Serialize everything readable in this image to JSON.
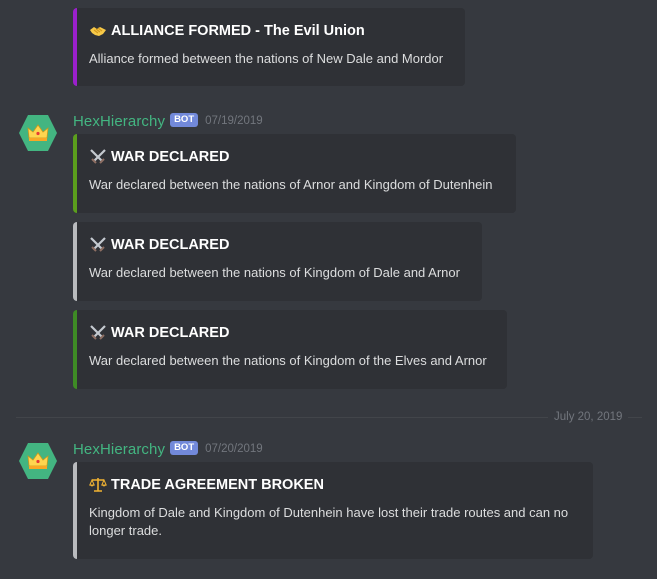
{
  "messages": [
    {
      "embeds": [
        {
          "emoji": "handshake-icon",
          "color": "#9b20cc",
          "title": "ALLIANCE FORMED - The Evil Union",
          "description": "Alliance formed between the nations of New Dale and Mordor"
        }
      ]
    },
    {
      "author": "HexHierarchy",
      "tag": "BOT",
      "timestamp": "07/19/2019",
      "avatar_icon": "crown-icon",
      "avatar_color": "#43b581",
      "embeds": [
        {
          "emoji": "crossed-swords-icon",
          "color": "#5b9e1d",
          "title": "WAR DECLARED",
          "description": "War declared between the nations of Arnor and Kingdom of Dutenhein"
        },
        {
          "emoji": "crossed-swords-icon",
          "color": "#b9bbbe",
          "title": "WAR DECLARED",
          "description": "War declared between the nations of Kingdom of Dale and Arnor"
        },
        {
          "emoji": "crossed-swords-icon",
          "color": "#3e8b25",
          "title": "WAR DECLARED",
          "description": "War declared between the nations of Kingdom of the Elves and Arnor"
        }
      ]
    },
    {
      "author": "HexHierarchy",
      "tag": "BOT",
      "timestamp": "07/20/2019",
      "avatar_icon": "crown-icon",
      "avatar_color": "#43b581",
      "embeds": [
        {
          "emoji": "scales-icon",
          "color": "#b9bbbe",
          "title": "TRADE AGREEMENT BROKEN",
          "description": "Kingdom of Dale and Kingdom of Dutenhein have lost their trade routes and can no longer trade."
        }
      ]
    }
  ],
  "divider": {
    "label": "July 20, 2019"
  }
}
